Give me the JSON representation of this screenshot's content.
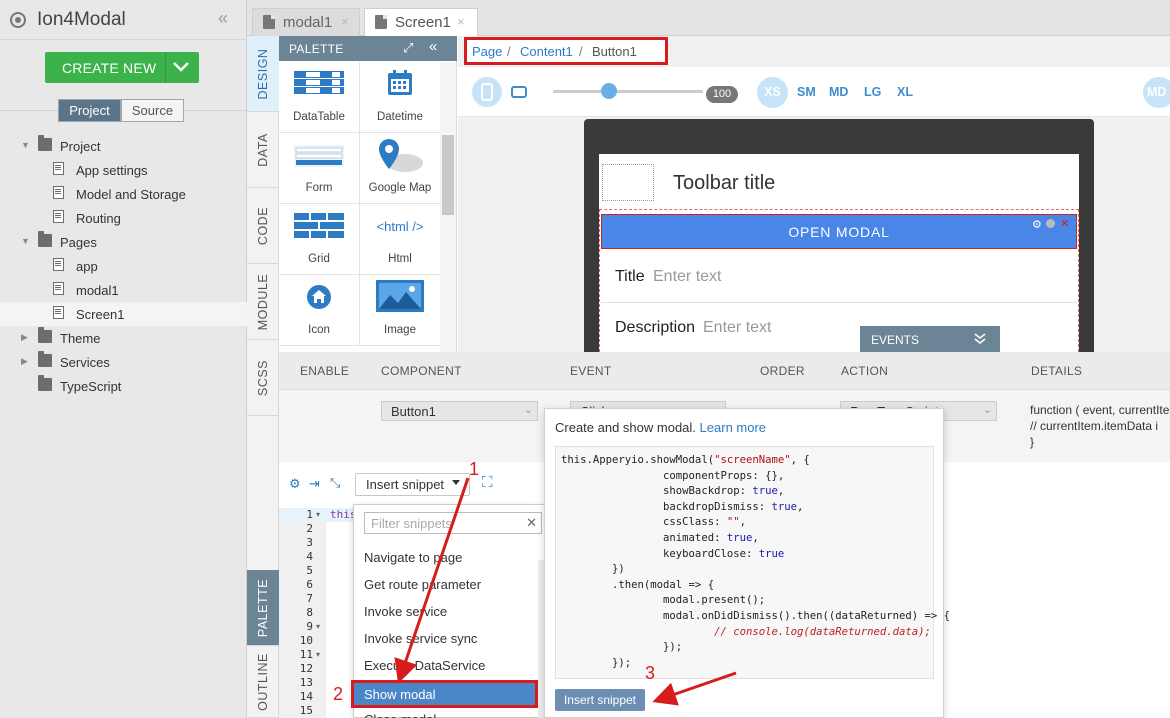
{
  "app": {
    "name": "Ion4Modal",
    "create_new": "CREATE NEW"
  },
  "sidebar": {
    "toggle": {
      "project": "Project",
      "source": "Source"
    },
    "tree": [
      {
        "label": "Project",
        "type": "folder",
        "expanded": true
      },
      {
        "label": "App settings",
        "type": "settings"
      },
      {
        "label": "Model and Storage",
        "type": "settings"
      },
      {
        "label": "Routing",
        "type": "settings"
      },
      {
        "label": "Pages",
        "type": "folder",
        "expanded": true
      },
      {
        "label": "app",
        "type": "page"
      },
      {
        "label": "modal1",
        "type": "page"
      },
      {
        "label": "Screen1",
        "type": "page",
        "selected": true
      },
      {
        "label": "Theme",
        "type": "folder",
        "expanded": false
      },
      {
        "label": "Services",
        "type": "folder",
        "expanded": false
      },
      {
        "label": "TypeScript",
        "type": "folder"
      }
    ]
  },
  "file_tabs": [
    {
      "label": "modal1",
      "close": "×"
    },
    {
      "label": "Screen1",
      "close": "×"
    }
  ],
  "vertical_tabs": {
    "design": "DESIGN",
    "data": "DATA",
    "code": "CODE",
    "module": "MODULE",
    "scss": "SCSS",
    "palette": "PALETTE",
    "outline": "OUTLINE"
  },
  "palette": {
    "title": "PALETTE",
    "items": [
      "DataTable",
      "Datetime",
      "Form",
      "Google Map",
      "Grid",
      "Html",
      "Icon",
      "Image"
    ],
    "html_glyph": "<html />"
  },
  "breadcrumb": {
    "page": "Page",
    "content": "Content1",
    "button": "Button1",
    "sep": "/"
  },
  "zoom": {
    "value": "100",
    "level": 0.37
  },
  "breakpoints": {
    "xs": "XS",
    "sm": "SM",
    "md": "MD",
    "lg": "LG",
    "xl": "XL",
    "md_right": "MD"
  },
  "preview": {
    "toolbar_title": "Toolbar title",
    "button": "OPEN MODAL",
    "title_label": "Title",
    "title_placeholder": "Enter text",
    "desc_label": "Description",
    "desc_placeholder": "Enter text"
  },
  "events": {
    "bar_label": "EVENTS",
    "headers": {
      "enable": "ENABLE",
      "component": "COMPONENT",
      "event": "EVENT",
      "order": "ORDER",
      "action": "ACTION",
      "details": "DETAILS"
    },
    "row": {
      "component": "Button1",
      "event": "Click",
      "action": "Run TypeScript"
    },
    "details": "function ( event, currentItem ) {\n// currentItem.itemData i\n}"
  },
  "editor": {
    "insert_snippet": "Insert snippet",
    "first_line": "this",
    "line_numbers": [
      "1",
      "2",
      "3",
      "4",
      "5",
      "6",
      "7",
      "8",
      "9",
      "10",
      "11",
      "12",
      "13",
      "14",
      "15"
    ]
  },
  "snippets": {
    "filter_placeholder": "Filter snippets",
    "items": [
      "Navigate to page",
      "Get route parameter",
      "Invoke service",
      "Invoke service sync",
      "Execute DataService",
      "Show modal",
      "Close modal"
    ]
  },
  "popover": {
    "text": "Create and show modal.",
    "learn_more": "Learn more",
    "insert_button": "Insert snippet",
    "code_lines": [
      "this.Apperyio.showModal(\"screenName\", {",
      "                componentProps: {},",
      "                showBackdrop: true,",
      "                backdropDismiss: true,",
      "                cssClass: \"\",",
      "                animated: true,",
      "                keyboardClose: true",
      "        })",
      "        .then(modal => {",
      "                modal.present();",
      "                modal.onDidDismiss().then((dataReturned) => {",
      "                        // console.log(dataReturned.data);",
      "                });",
      "        });"
    ]
  },
  "annotations": {
    "one": "1",
    "two": "2",
    "three": "3"
  },
  "colors": {
    "accent_blue": "#4a86e8",
    "create_green": "#3bb34a",
    "highlight_red": "#d61c1c",
    "slate": "#6b8597"
  }
}
